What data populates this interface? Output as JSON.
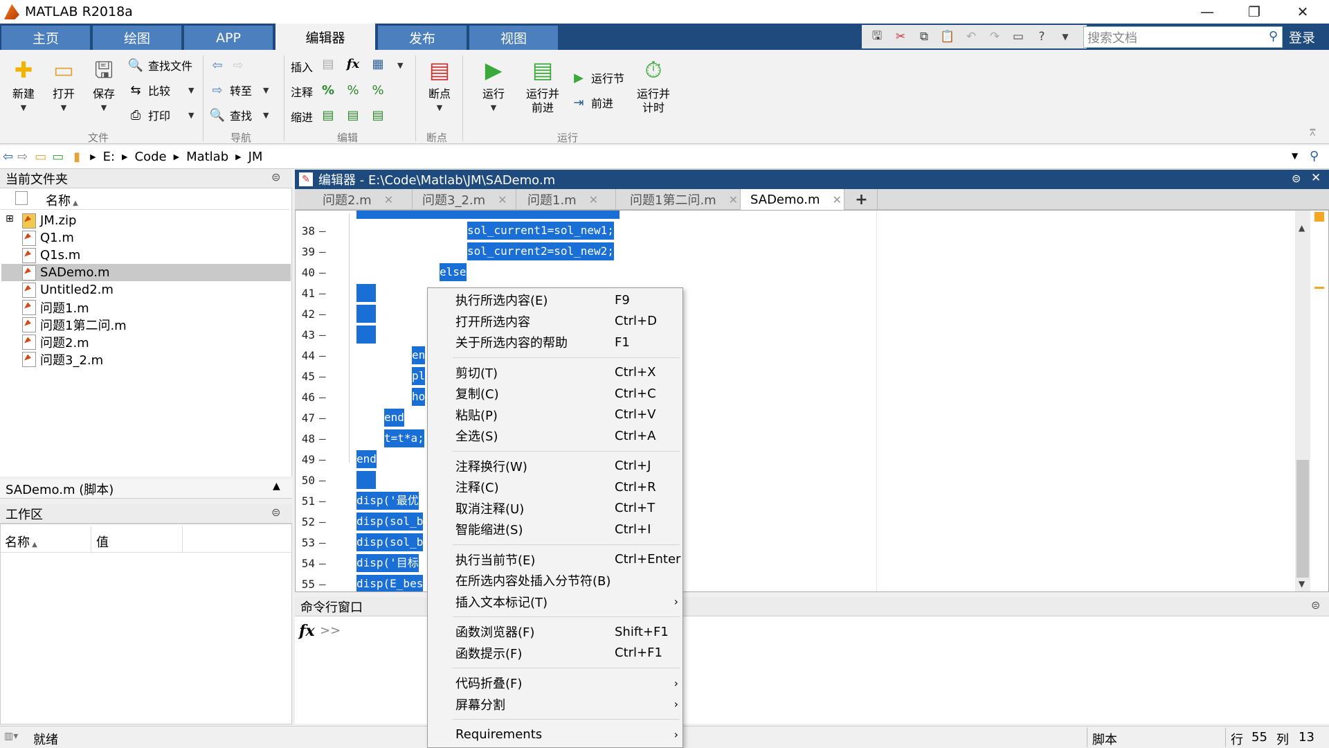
{
  "app": {
    "title": "MATLAB R2018a"
  },
  "tabs": [
    "主页",
    "绘图",
    "APP",
    "编辑器",
    "发布",
    "视图"
  ],
  "search": {
    "placeholder": "搜索文档"
  },
  "login": "登录",
  "ribbon": {
    "file": {
      "new": "新建",
      "open": "打开",
      "save": "保存",
      "find_files": "查找文件",
      "compare": "比较",
      "print": "打印",
      "group": "文件"
    },
    "nav": {
      "goto": "转至",
      "find": "查找",
      "group": "导航"
    },
    "edit": {
      "insert": "插入",
      "comment": "注释",
      "indent": "缩进",
      "fx": "fx",
      "pct": "%",
      "group": "编辑"
    },
    "breakpoints": {
      "label": "断点",
      "group": "断点"
    },
    "run": {
      "run": "运行",
      "run_advance_1": "运行并",
      "run_advance_2": "前进",
      "run_section": "运行节",
      "advance": "前进",
      "run_time_1": "运行并",
      "run_time_2": "计时",
      "group": "运行"
    }
  },
  "address": {
    "parts": [
      "E:",
      "Code",
      "Matlab",
      "JM"
    ]
  },
  "current_folder": {
    "title": "当前文件夹",
    "col_name": "名称",
    "files": [
      "JM.zip",
      "Q1.m",
      "Q1s.m",
      "SADemo.m",
      "Untitled2.m",
      "问题1.m",
      "问题1第二问.m",
      "问题2.m",
      "问题3_2.m"
    ],
    "selected": "SADemo.m"
  },
  "details": {
    "title": "SADemo.m (脚本)"
  },
  "workspace": {
    "title": "工作区",
    "col_name": "名称",
    "col_value": "值"
  },
  "editor": {
    "title": "编辑器 - E:\\Code\\Matlab\\JM\\SADemo.m",
    "tabs": [
      "问题2.m",
      "问题3_2.m",
      "问题1.m",
      "问题1第二问.m",
      "SADemo.m"
    ],
    "active_tab": "SADemo.m",
    "add_tab": "+",
    "lines": [
      {
        "n": "38",
        "t": "sol_current1=sol_new1;"
      },
      {
        "n": "39",
        "t": "sol_current2=sol_new2;"
      },
      {
        "n": "40",
        "t": "else"
      },
      {
        "n": "41",
        "t": ""
      },
      {
        "n": "42",
        "t": ""
      },
      {
        "n": "43",
        "t": ""
      },
      {
        "n": "44",
        "t": "en"
      },
      {
        "n": "45",
        "t": "pl"
      },
      {
        "n": "46",
        "t": "ho"
      },
      {
        "n": "47",
        "t": "end"
      },
      {
        "n": "48",
        "t": "t=t*a;"
      },
      {
        "n": "49",
        "t": "end"
      },
      {
        "n": "50",
        "t": ""
      },
      {
        "n": "51",
        "t": "disp('最优"
      },
      {
        "n": "52",
        "t": "disp(sol_b"
      },
      {
        "n": "53",
        "t": "disp(sol_b"
      },
      {
        "n": "54",
        "t": "disp('目标"
      },
      {
        "n": "55",
        "t": "disp(E_bes"
      }
    ]
  },
  "command_window": {
    "title": "命令行窗口",
    "prompt": ">>",
    "fx": "fx"
  },
  "context_menu": {
    "items": [
      {
        "label": "执行所选内容(E)",
        "shortcut": "F9"
      },
      {
        "label": "打开所选内容",
        "shortcut": "Ctrl+D"
      },
      {
        "label": "关于所选内容的帮助",
        "shortcut": "F1"
      },
      {
        "label": "剪切(T)",
        "shortcut": "Ctrl+X"
      },
      {
        "label": "复制(C)",
        "shortcut": "Ctrl+C"
      },
      {
        "label": "粘贴(P)",
        "shortcut": "Ctrl+V"
      },
      {
        "label": "全选(S)",
        "shortcut": "Ctrl+A"
      },
      {
        "label": "注释换行(W)",
        "shortcut": "Ctrl+J"
      },
      {
        "label": "注释(C)",
        "shortcut": "Ctrl+R"
      },
      {
        "label": "取消注释(U)",
        "shortcut": "Ctrl+T"
      },
      {
        "label": "智能缩进(S)",
        "shortcut": "Ctrl+I"
      },
      {
        "label": "执行当前节(E)",
        "shortcut": "Ctrl+Enter"
      },
      {
        "label": "在所选内容处插入分节符(B)",
        "shortcut": ""
      },
      {
        "label": "插入文本标记(T)",
        "shortcut": ""
      },
      {
        "label": "函数浏览器(F)",
        "shortcut": "Shift+F1"
      },
      {
        "label": "函数提示(F)",
        "shortcut": "Ctrl+F1"
      },
      {
        "label": "代码折叠(F)",
        "shortcut": ""
      },
      {
        "label": "屏幕分割",
        "shortcut": ""
      },
      {
        "label": "Requirements",
        "shortcut": ""
      }
    ]
  },
  "status": {
    "ready": "就绪",
    "mode": "脚本",
    "row_label": "行",
    "row": "55",
    "col_label": "列",
    "col": "13"
  },
  "colors": {
    "titlebar_blue": "#1e4a7e",
    "tab_blue": "#4b7fbd",
    "selection": "#1a6fd6"
  }
}
